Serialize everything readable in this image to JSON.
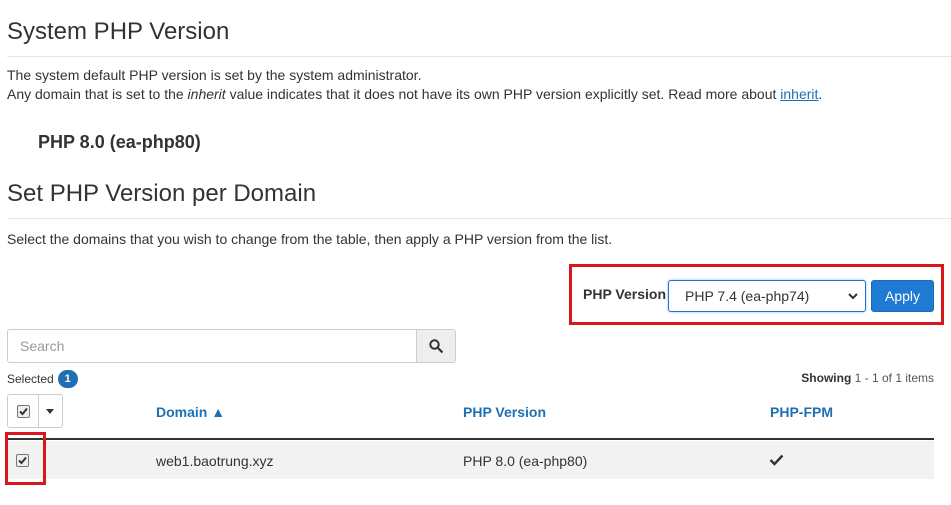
{
  "system": {
    "title": "System PHP Version",
    "desc_line1": "The system default PHP version is set by the system administrator.",
    "desc_line2_pre": "Any domain that is set to the ",
    "desc_line2_em": "inherit",
    "desc_line2_post": " value indicates that it does not have its own PHP version explicitly set. Read more about ",
    "desc_link": "inherit",
    "desc_end": ".",
    "current_version": "PHP 8.0 (ea-php80)"
  },
  "per_domain": {
    "title": "Set PHP Version per Domain",
    "instructions": "Select the domains that you wish to change from the table, then apply a PHP version from the list.",
    "php_version_label": "PHP Version",
    "selected_version": "PHP 7.4 (ea-php74)",
    "apply_label": "Apply",
    "search_placeholder": "Search",
    "selected_label": "Selected",
    "selected_count": "1",
    "showing_label": "Showing",
    "showing_range": "1 - 1 of 1 items"
  },
  "table": {
    "columns": [
      "Domain ▲",
      "PHP Version",
      "PHP-FPM"
    ],
    "rows": [
      {
        "domain": "web1.baotrung.xyz",
        "php_version": "PHP 8.0 (ea-php80)",
        "fpm_enabled": true,
        "checked": true
      }
    ]
  },
  "colors": {
    "link": "#1f6fb2",
    "primary_button": "#1e7ad3",
    "highlight_border": "#d9161c"
  },
  "icons": [
    "search-icon",
    "check-icon",
    "caret-down-icon",
    "chevron-down-icon"
  ]
}
